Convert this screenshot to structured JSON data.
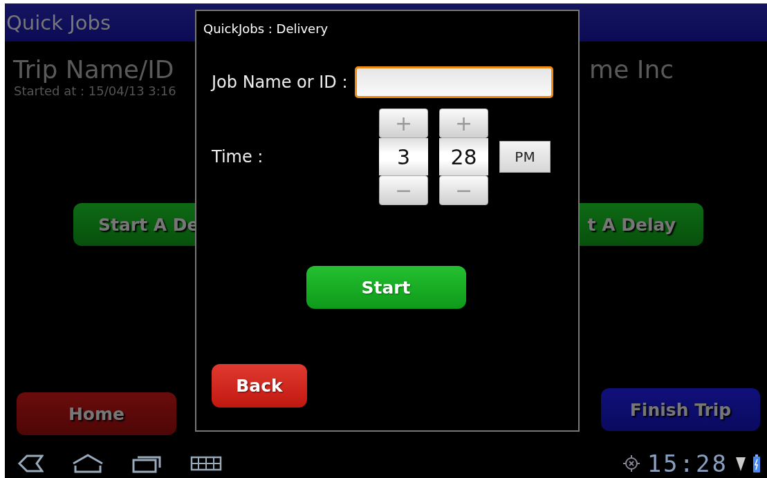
{
  "app_bar": {
    "title": "Quick Jobs"
  },
  "trip": {
    "label": "Trip Name/ID",
    "company": "me Inc",
    "started": "Started at : 15/04/13 3:16"
  },
  "delivery_button": "Start A De",
  "delay_button": "t A Delay",
  "home_button": "Home",
  "finish_button": "Finish Trip",
  "dialog": {
    "title": "QuickJobs : Delivery",
    "job_label": "Job Name or ID :",
    "time_label": "Time :",
    "spinners": [
      {
        "plus": "+",
        "value": "3",
        "minus": "−"
      },
      {
        "plus": "+",
        "value": "28",
        "minus": "−"
      }
    ],
    "ampm": "PM",
    "start_button": "Start",
    "back_button": "Back"
  },
  "status_bar": {
    "time": "15:28"
  }
}
